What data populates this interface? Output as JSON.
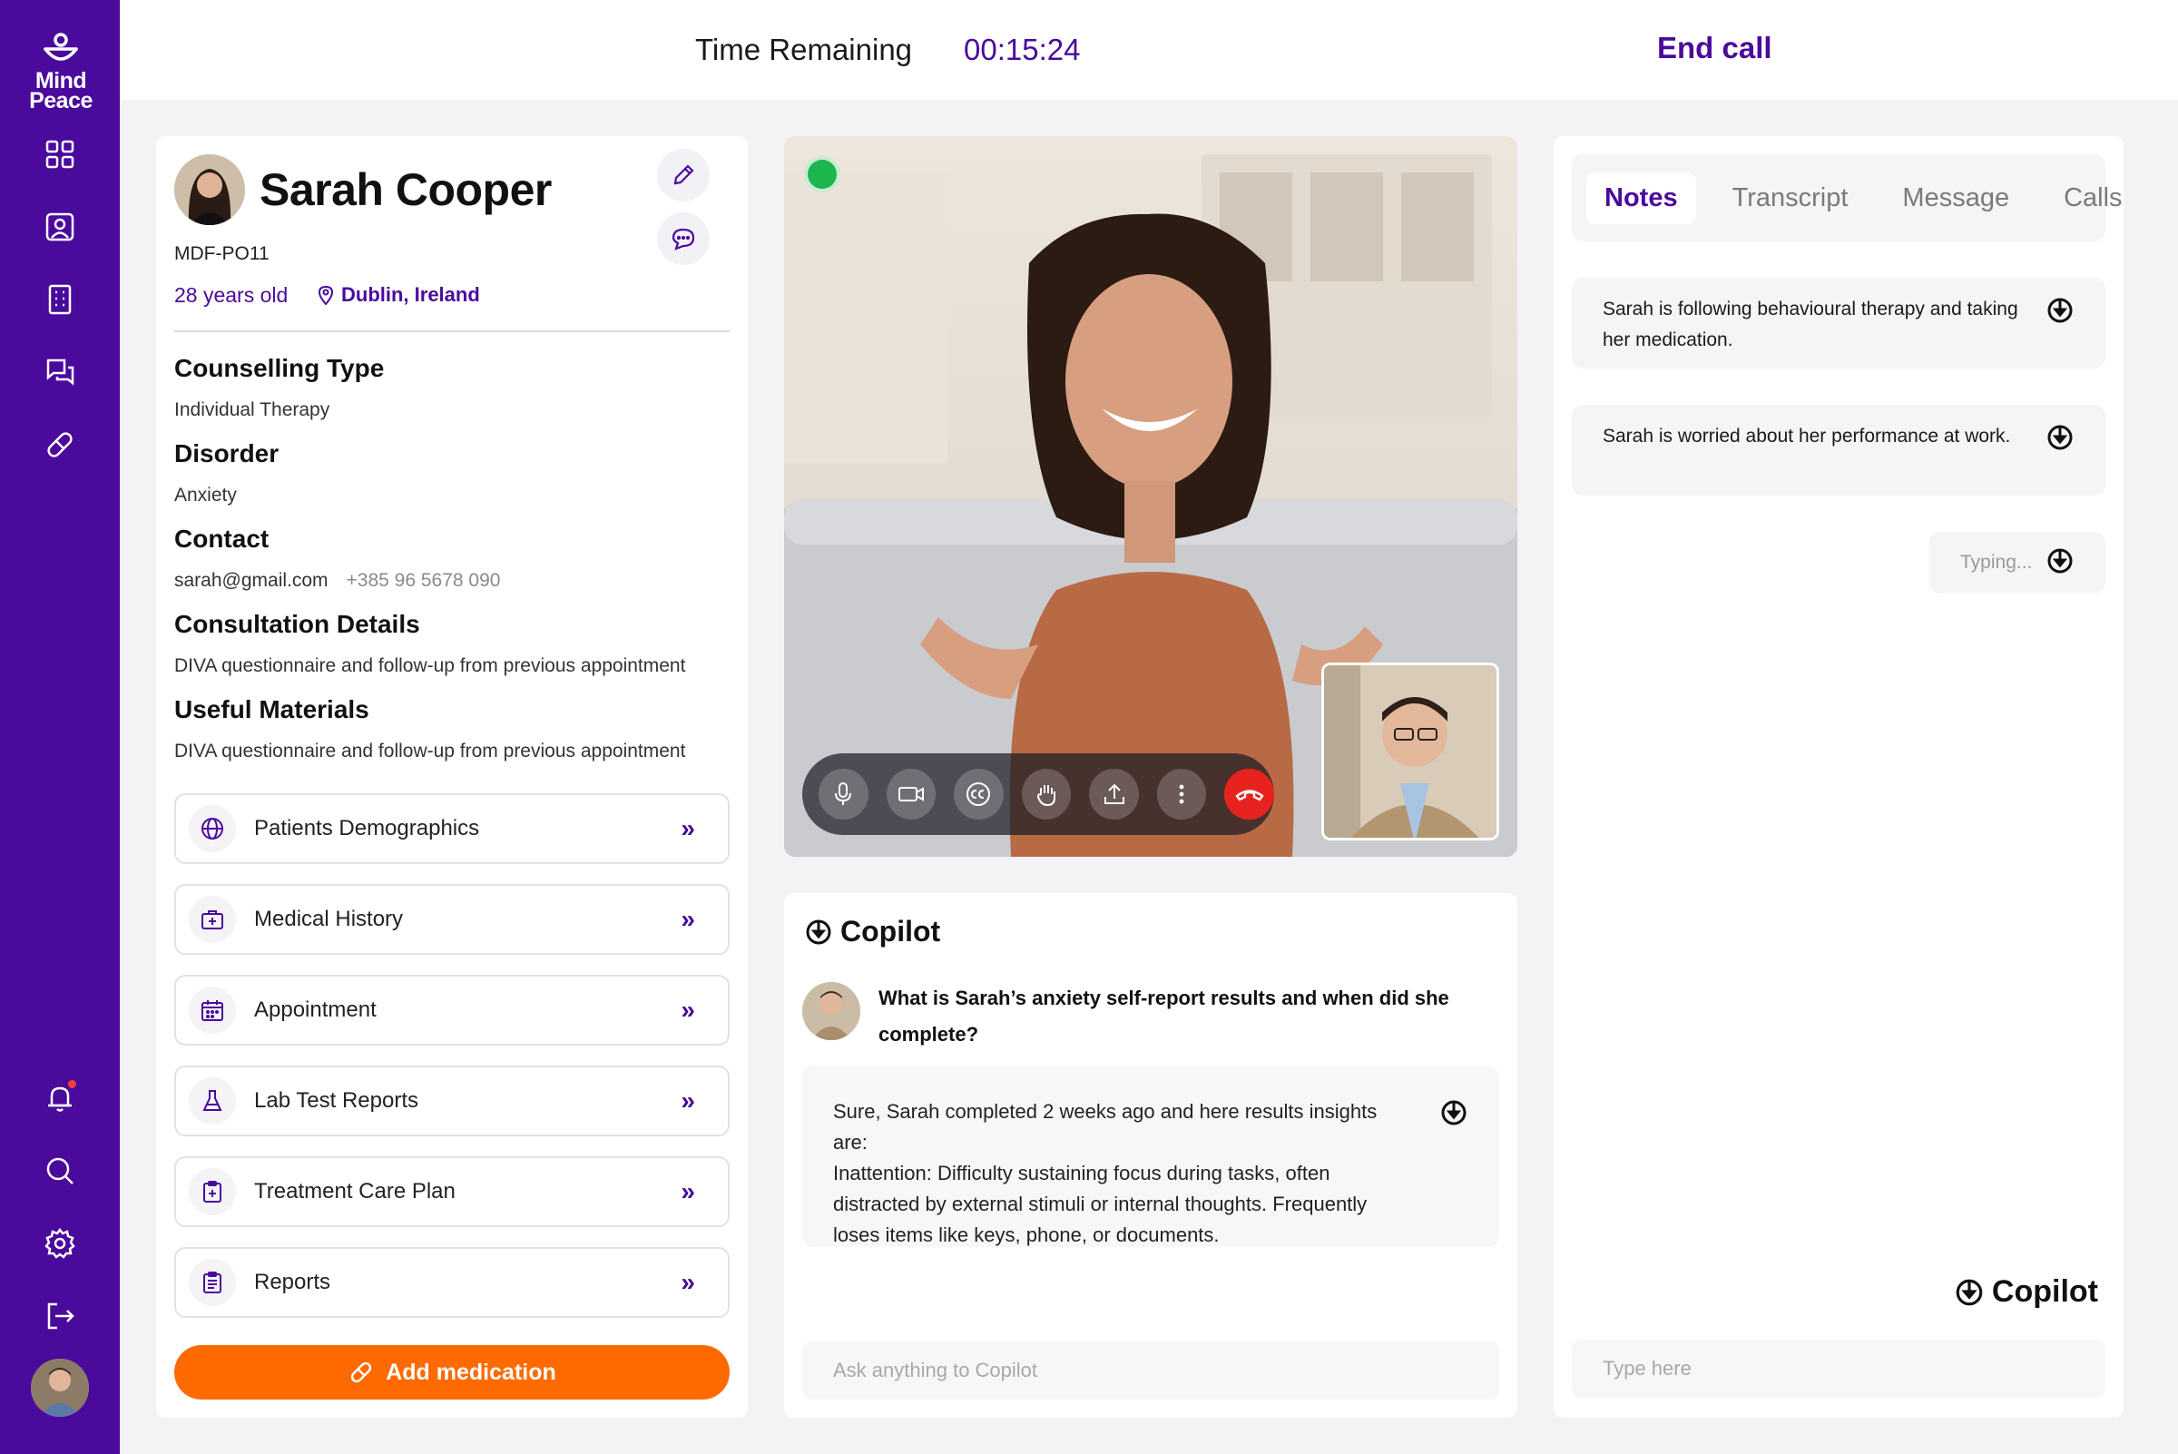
{
  "app": {
    "logo_line1": "Mind",
    "logo_line2": "Peace"
  },
  "sidebar": {
    "items": [
      {
        "name": "dashboard",
        "icon": "grid-icon"
      },
      {
        "name": "patients",
        "icon": "user-card-icon"
      },
      {
        "name": "building",
        "icon": "building-icon"
      },
      {
        "name": "messages",
        "icon": "chat-icon"
      },
      {
        "name": "medication",
        "icon": "pill-icon"
      }
    ],
    "bottom_items": [
      {
        "name": "notifications",
        "icon": "bell-icon"
      },
      {
        "name": "search",
        "icon": "search-icon"
      },
      {
        "name": "settings",
        "icon": "gear-icon"
      },
      {
        "name": "logout",
        "icon": "logout-icon"
      }
    ]
  },
  "topbar": {
    "time_label": "Time Remaining",
    "time_value": "00:15:24",
    "end_call": "End call"
  },
  "patient": {
    "name": "Sarah Cooper",
    "id": "MDF-PO11",
    "age": "28 years old",
    "location": "Dublin, Ireland",
    "sections": {
      "counselling_title": "Counselling Type",
      "counselling_value": "Individual Therapy",
      "disorder_title": "Disorder",
      "disorder_value": "Anxiety",
      "contact_title": "Contact",
      "contact_email": "sarah@gmail.com",
      "contact_phone": "+385 96 5678 090",
      "consultation_title": "Consultation Details",
      "consultation_value": "DIVA questionnaire and follow-up from previous appointment",
      "materials_title": "Useful Materials",
      "materials_value": "DIVA questionnaire and follow-up from previous appointment"
    },
    "menu": [
      {
        "label": "Patients Demographics",
        "icon": "globe-icon"
      },
      {
        "label": "Medical History",
        "icon": "medical-bag-icon"
      },
      {
        "label": "Appointment",
        "icon": "calendar-icon"
      },
      {
        "label": "Lab Test Reports",
        "icon": "flask-icon"
      },
      {
        "label": "Treatment Care Plan",
        "icon": "clipboard-plus-icon"
      },
      {
        "label": "Reports",
        "icon": "clipboard-icon"
      }
    ],
    "add_medication": "Add medication"
  },
  "copilot": {
    "title": "Copilot",
    "question": "What is Sarah’s anxiety self-report results and when did she complete?",
    "answer_line1": "Sure, Sarah completed 2 weeks ago and here results insights are:",
    "answer_line2": "Inattention: Difficulty sustaining focus during tasks, often distracted by external stimuli or internal thoughts. Frequently loses items like keys, phone, or documents.",
    "input_placeholder": "Ask anything to Copilot"
  },
  "notes_panel": {
    "tabs": [
      "Notes",
      "Transcript",
      "Message",
      "Calls"
    ],
    "active_tab": "Notes",
    "notes": [
      "Sarah is following behavioural therapy and taking her medication.",
      "Sarah is worried about her performance at work."
    ],
    "typing": "Typing...",
    "brand": "Copilot",
    "input_placeholder": "Type here"
  },
  "colors": {
    "brand": "#4a0a9c",
    "accent": "#ff6a00",
    "live": "#1db64c",
    "hangup": "#e8231f"
  }
}
